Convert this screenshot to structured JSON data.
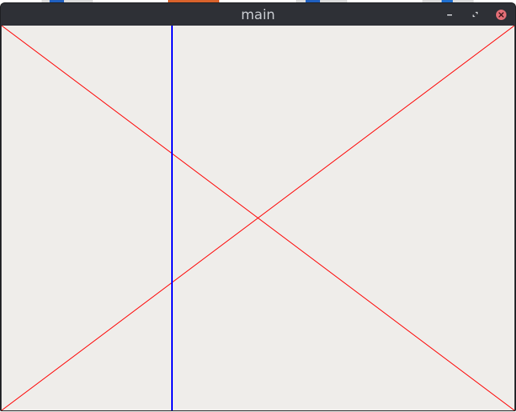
{
  "window": {
    "title": "main"
  },
  "controls": {
    "minimize_icon": "minimize-icon",
    "maximize_icon": "restore-icon",
    "close_icon": "close-icon"
  },
  "canvas": {
    "background_color": "#efedea",
    "diagonal_color": "#ff0000",
    "vertical_line_color": "#0000ff"
  },
  "colors": {
    "titlebar": "#2e3036",
    "title_text": "#c9ccd1",
    "close_button": "#e46f77"
  }
}
